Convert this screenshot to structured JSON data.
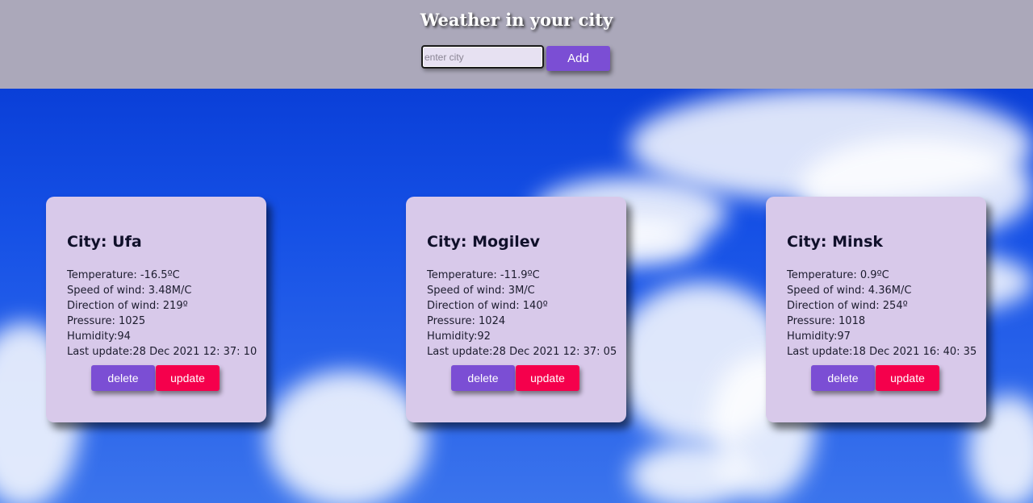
{
  "header": {
    "title": "Weather in your city",
    "search_placeholder": "enter city",
    "search_value": "",
    "add_label": "Add"
  },
  "colors": {
    "header_bg": "#aba8ba",
    "accent": "#7b4ed4",
    "update": "#f5004c",
    "card_bg": "#d8c9ea",
    "sky": "#1651e6"
  },
  "cards": [
    {
      "city": "City: Ufa",
      "temperature": "Temperature: -16.5ºC",
      "wind_speed": "Speed of wind: 3.48M/C",
      "wind_direction": "Direction of wind: 219º",
      "pressure": "Pressure: 1025",
      "humidity": "Humidity:94",
      "last_update": "Last update:28 Dec 2021 12: 37: 10",
      "delete_label": "delete",
      "update_label": "update"
    },
    {
      "city": "City: Mogilev",
      "temperature": "Temperature: -11.9ºC",
      "wind_speed": "Speed of wind: 3M/C",
      "wind_direction": "Direction of wind: 140º",
      "pressure": "Pressure: 1024",
      "humidity": "Humidity:92",
      "last_update": "Last update:28 Dec 2021 12: 37: 05",
      "delete_label": "delete",
      "update_label": "update"
    },
    {
      "city": "City: Minsk",
      "temperature": "Temperature: 0.9ºC",
      "wind_speed": "Speed of wind: 4.36M/C",
      "wind_direction": "Direction of wind: 254º",
      "pressure": "Pressure: 1018",
      "humidity": "Humidity:97",
      "last_update": "Last update:18 Dec 2021 16: 40: 35",
      "delete_label": "delete",
      "update_label": "update"
    }
  ]
}
